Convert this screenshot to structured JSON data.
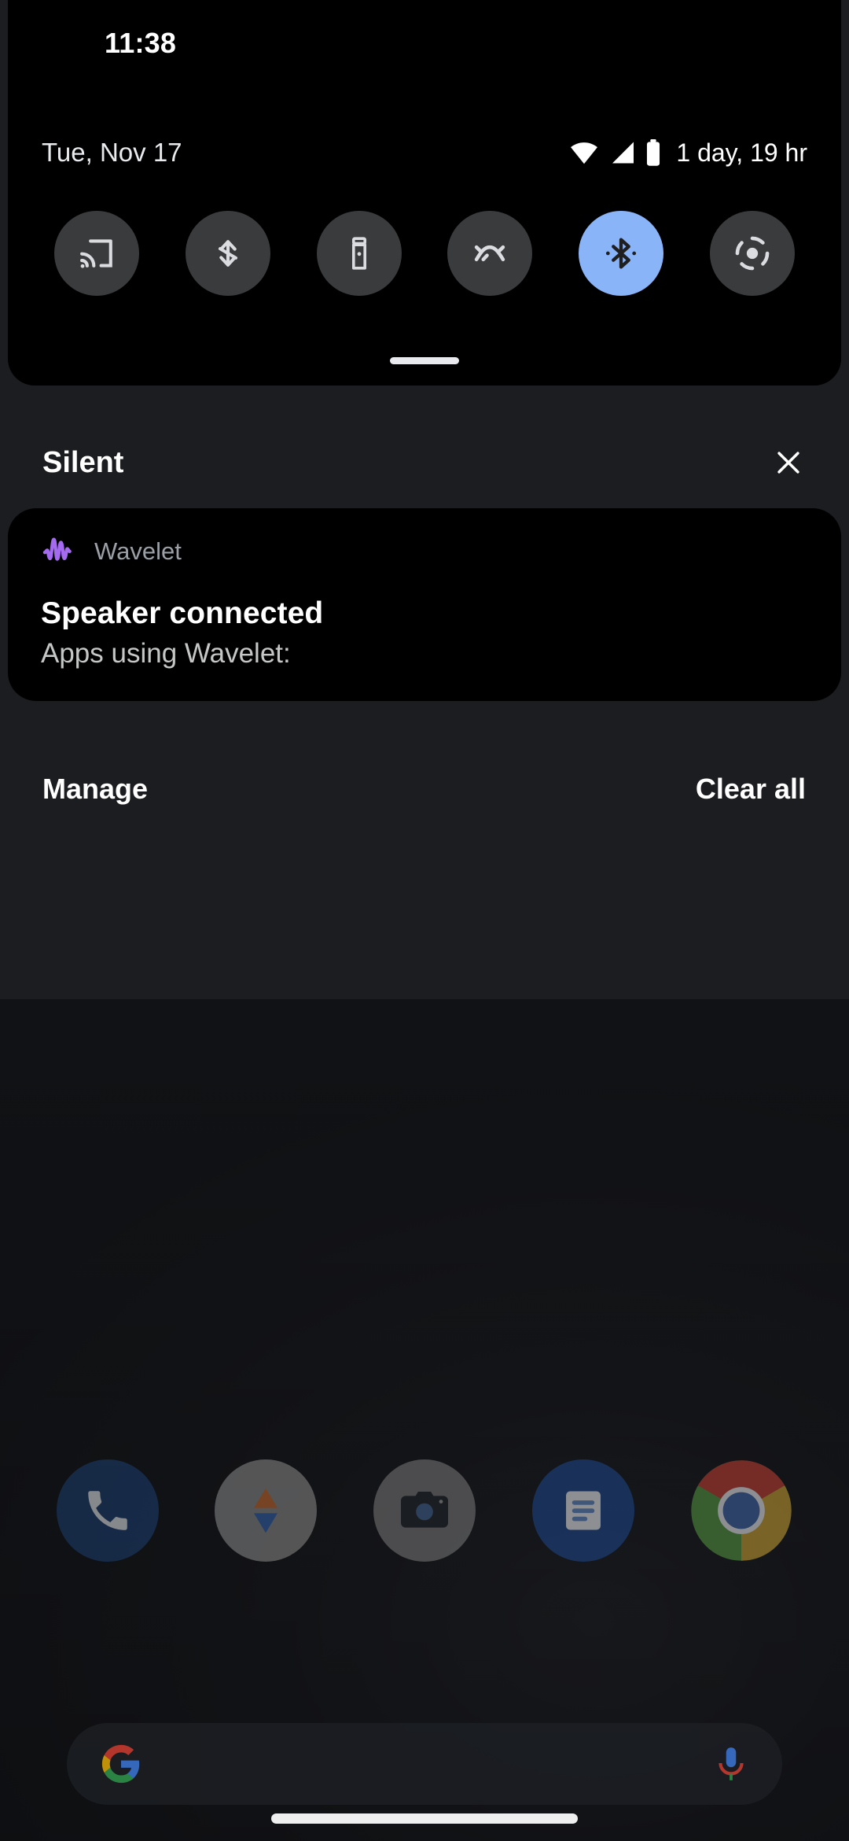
{
  "status_bar": {
    "clock": "11:38"
  },
  "quick_settings": {
    "date": "Tue, Nov 17",
    "battery_estimate": "1 day, 19 hr",
    "status_icons": [
      {
        "name": "wifi-icon"
      },
      {
        "name": "cellular-signal-icon"
      },
      {
        "name": "battery-icon"
      }
    ],
    "tiles": [
      {
        "label": "Screen Cast",
        "icon": "cast-icon",
        "active": false
      },
      {
        "label": "Auto-rotate",
        "icon": "auto-rotate-icon",
        "active": false
      },
      {
        "label": "Flashlight",
        "icon": "flashlight-icon",
        "active": false
      },
      {
        "label": "Data Saver",
        "icon": "data-saver-icon",
        "active": false
      },
      {
        "label": "Bluetooth",
        "icon": "bluetooth-icon",
        "active": true
      },
      {
        "label": "Do Not Disturb",
        "icon": "dnd-icon",
        "active": false
      }
    ],
    "handle": "drag-handle"
  },
  "notification_section": {
    "header_label": "Silent",
    "close_icon": "close-icon",
    "notifications": [
      {
        "app_name": "Wavelet",
        "app_icon": "wavelet-waveform-icon",
        "title": "Speaker connected",
        "text": "Apps using Wavelet:"
      }
    ],
    "manage_label": "Manage",
    "clear_all_label": "Clear all"
  },
  "home_screen": {
    "dock_apps": [
      {
        "label": "Phone",
        "icon": "phone-icon"
      },
      {
        "label": "Photos",
        "icon": "photos-icon"
      },
      {
        "label": "Camera",
        "icon": "camera-icon"
      },
      {
        "label": "Messages",
        "icon": "messages-icon"
      },
      {
        "label": "Chrome",
        "icon": "chrome-icon"
      }
    ],
    "search": {
      "google_icon": "google-g-icon",
      "mic_icon": "microphone-icon",
      "placeholder": ""
    },
    "nav_pill": "home-gesture-pill"
  },
  "colors": {
    "accent_blue": "#8ab4f8",
    "tile_inactive": "#3a3b3d",
    "shade_bg": "#1c1d20",
    "wavelet_purple": "#a46bf0"
  }
}
